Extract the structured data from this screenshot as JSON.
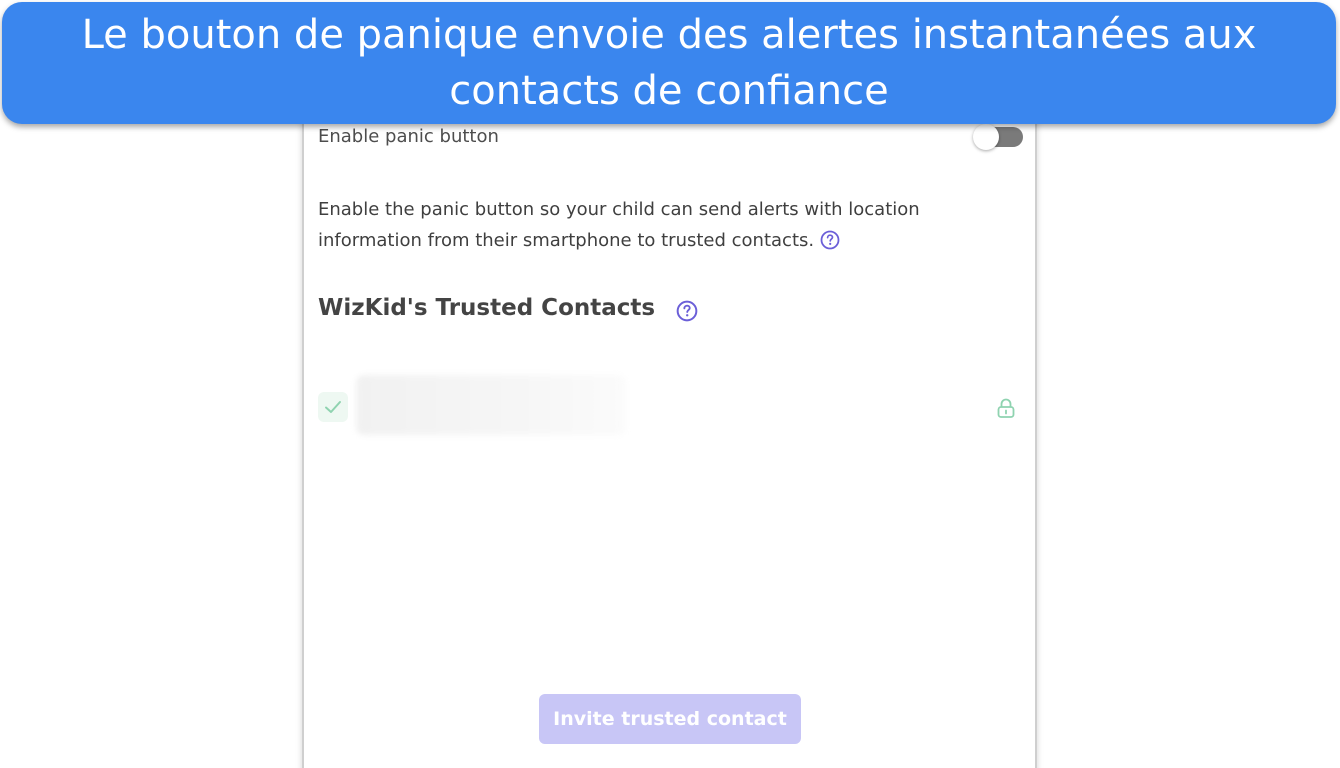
{
  "banner": {
    "caption": "Le bouton de panique envoie des alertes instantanées aux contacts de confiance"
  },
  "panic": {
    "toggle_label": "Enable panic button",
    "toggle_state": "off",
    "description": "Enable the panic button so your child can send alerts with location information from their smartphone to trusted contacts."
  },
  "contacts": {
    "title": "WizKid's Trusted Contacts",
    "invite_label": "Invite trusted contact"
  },
  "icons": {
    "help": "question-circle-icon",
    "check": "check-icon",
    "lock": "lock-icon"
  },
  "colors": {
    "banner": "#3a86ee",
    "accent": "#6b5fd8",
    "check": "#8fd3b0",
    "invite_button": "#c8c6f6"
  }
}
